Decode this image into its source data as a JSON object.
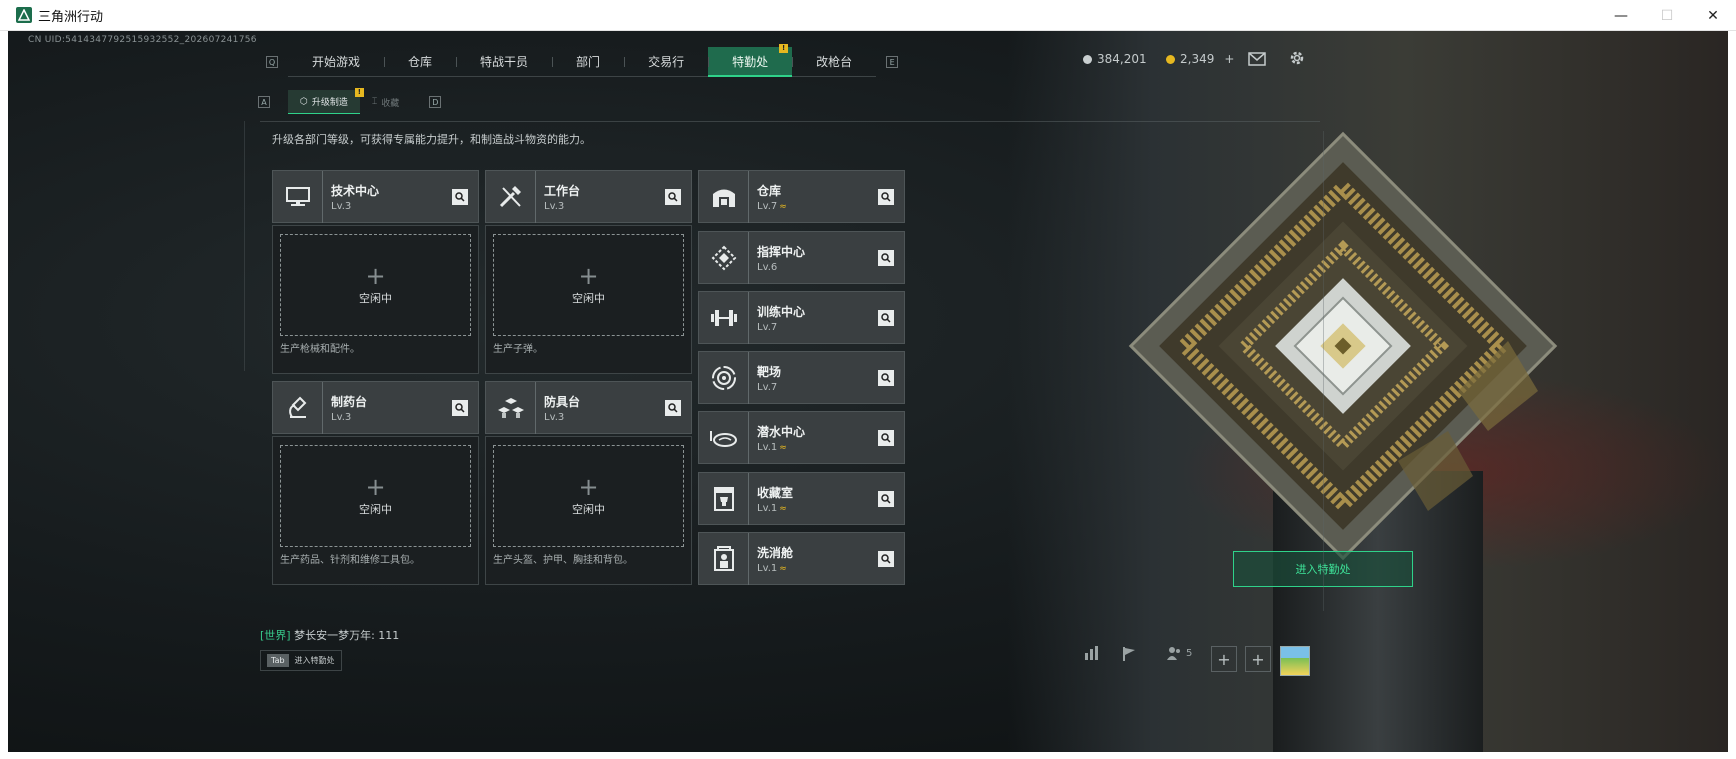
{
  "window": {
    "title": "三角洲行动",
    "minimize": "—",
    "maximize": "☐",
    "close": "✕"
  },
  "uid": "CN UID:5414347792515932552_202607241756",
  "nav": {
    "left_key": "Q",
    "right_key": "E",
    "tabs": [
      {
        "label": "开始游戏"
      },
      {
        "label": "仓库"
      },
      {
        "label": "特战干员"
      },
      {
        "label": "部门"
      },
      {
        "label": "交易行"
      },
      {
        "label": "特勤处",
        "badge": "!"
      },
      {
        "label": "改枪台"
      }
    ]
  },
  "subnav": {
    "left_key": "A",
    "right_key": "D",
    "tabs": [
      {
        "label": "升级制造",
        "badge": "!"
      },
      {
        "label": "收藏"
      }
    ]
  },
  "description": "升级各部门等级，可获得专属能力提升，和制造战斗物资的能力。",
  "production": [
    {
      "name": "技术中心",
      "level": "Lv.3",
      "icon": "computer-icon",
      "status": "空闲中",
      "plus": "+",
      "desc": "生产枪械和配件。"
    },
    {
      "name": "工作台",
      "level": "Lv.3",
      "icon": "tools-icon",
      "status": "空闲中",
      "plus": "+",
      "desc": "生产子弹。"
    },
    {
      "name": "制药台",
      "level": "Lv.3",
      "icon": "microscope-icon",
      "status": "空闲中",
      "plus": "+",
      "desc": "生产药品、针剂和维修工具包。"
    },
    {
      "name": "防具台",
      "level": "Lv.3",
      "icon": "armor-blocks-icon",
      "status": "空闲中",
      "plus": "+",
      "desc": "生产头盔、护甲、胸挂和背包。"
    }
  ],
  "departments": [
    {
      "name": "仓库",
      "level": "Lv.7",
      "upgrade": true,
      "icon": "warehouse-icon"
    },
    {
      "name": "指挥中心",
      "level": "Lv.6",
      "upgrade": false,
      "icon": "command-icon"
    },
    {
      "name": "训练中心",
      "level": "Lv.7",
      "upgrade": false,
      "icon": "dumbbell-icon"
    },
    {
      "name": "靶场",
      "level": "Lv.7",
      "upgrade": false,
      "icon": "target-icon"
    },
    {
      "name": "潜水中心",
      "level": "Lv.1",
      "upgrade": true,
      "icon": "diving-mask-icon"
    },
    {
      "name": "收藏室",
      "level": "Lv.1",
      "upgrade": true,
      "icon": "trophy-case-icon"
    },
    {
      "name": "洗消舱",
      "level": "Lv.1",
      "upgrade": true,
      "icon": "decontamination-icon"
    }
  ],
  "upgrade_glyph": "≈",
  "resources": {
    "coins": "384,201",
    "tickets": "2,349",
    "add": "+"
  },
  "chat": {
    "channel": "[世界]",
    "message": "梦长安一梦万年: 111"
  },
  "tab_hint": {
    "key": "Tab",
    "label": "进入特勤处"
  },
  "enter_button": "进入特勤处",
  "bottom_bar": {
    "team_count": "5"
  }
}
